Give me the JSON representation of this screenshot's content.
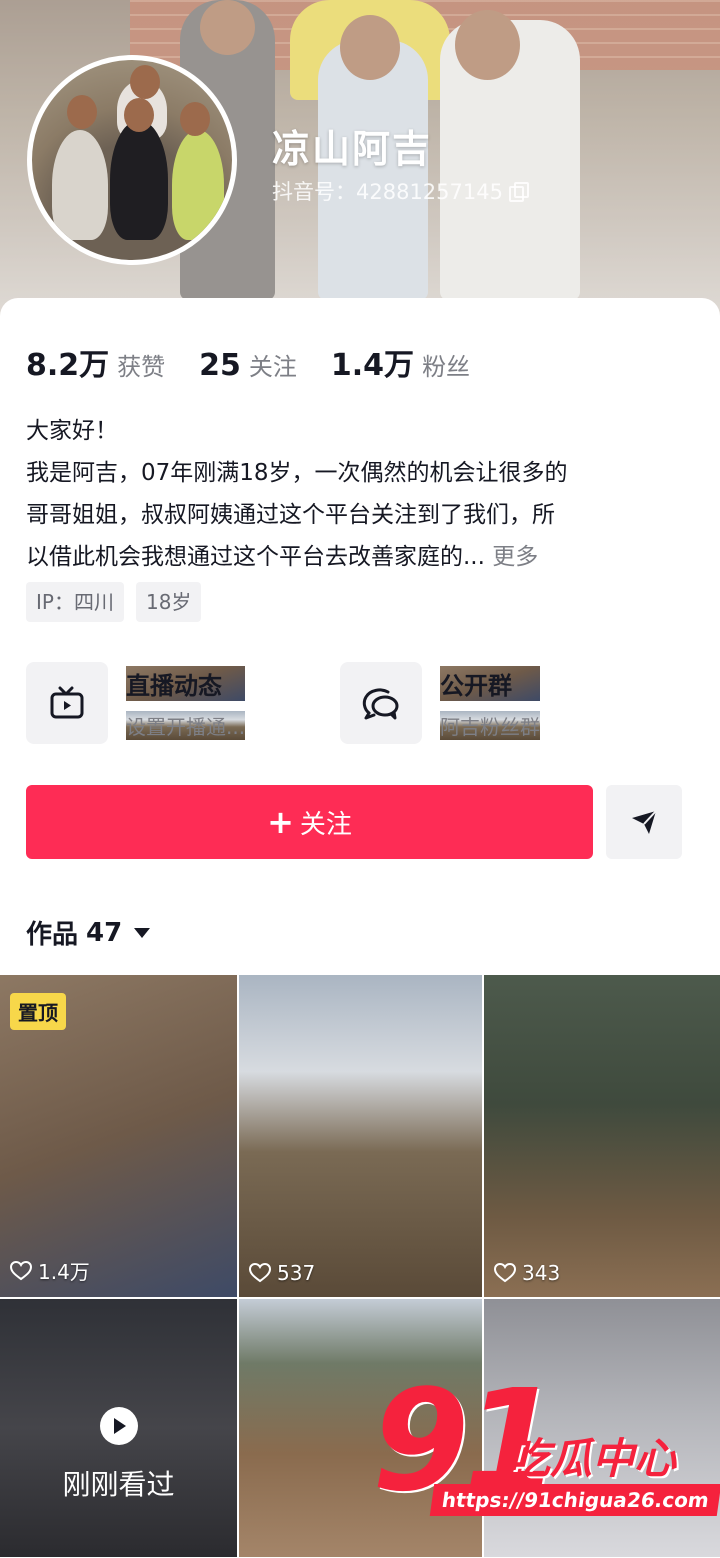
{
  "profile": {
    "name": "凉山阿吉",
    "douyin_id": "抖音号：42881257145"
  },
  "stats": [
    {
      "value": "8.2万",
      "label": "获赞"
    },
    {
      "value": "25",
      "label": "关注"
    },
    {
      "value": "1.4万",
      "label": "粉丝"
    }
  ],
  "bio": {
    "line1": "大家好！",
    "line2": "我是阿吉，07年刚满18岁，一次偶然的机会让很多的",
    "line3": "哥哥姐姐，叔叔阿姨通过这个平台关注到了我们，所",
    "line4": "以借此机会我想通过这个平台去改善家庭的...",
    "more": "更多"
  },
  "tags": [
    "IP：四川",
    "18岁"
  ],
  "features": {
    "live": {
      "title": "直播动态",
      "subtitle": "设置开播通...",
      "icon": "tv-icon"
    },
    "group": {
      "title": "公开群",
      "subtitle": "阿吉粉丝群",
      "icon": "chat-bubble-icon"
    }
  },
  "actions": {
    "follow_plus": "+",
    "follow_label": "关注",
    "share_icon": "send-icon"
  },
  "works": {
    "label": "作品",
    "count": "47"
  },
  "videos": [
    {
      "pinned": "置顶",
      "likes": "1.4万"
    },
    {
      "likes": "537"
    },
    {
      "likes": "343"
    },
    {
      "viewed_label": "刚刚看过"
    },
    {},
    {}
  ],
  "watermark": {
    "number": "91",
    "text": "吃瓜中心",
    "url": "https://91chigua26.com"
  },
  "colors": {
    "accent": "#fe2c55",
    "pin_bg": "#f7d74a",
    "watermark": "#f5223d"
  }
}
